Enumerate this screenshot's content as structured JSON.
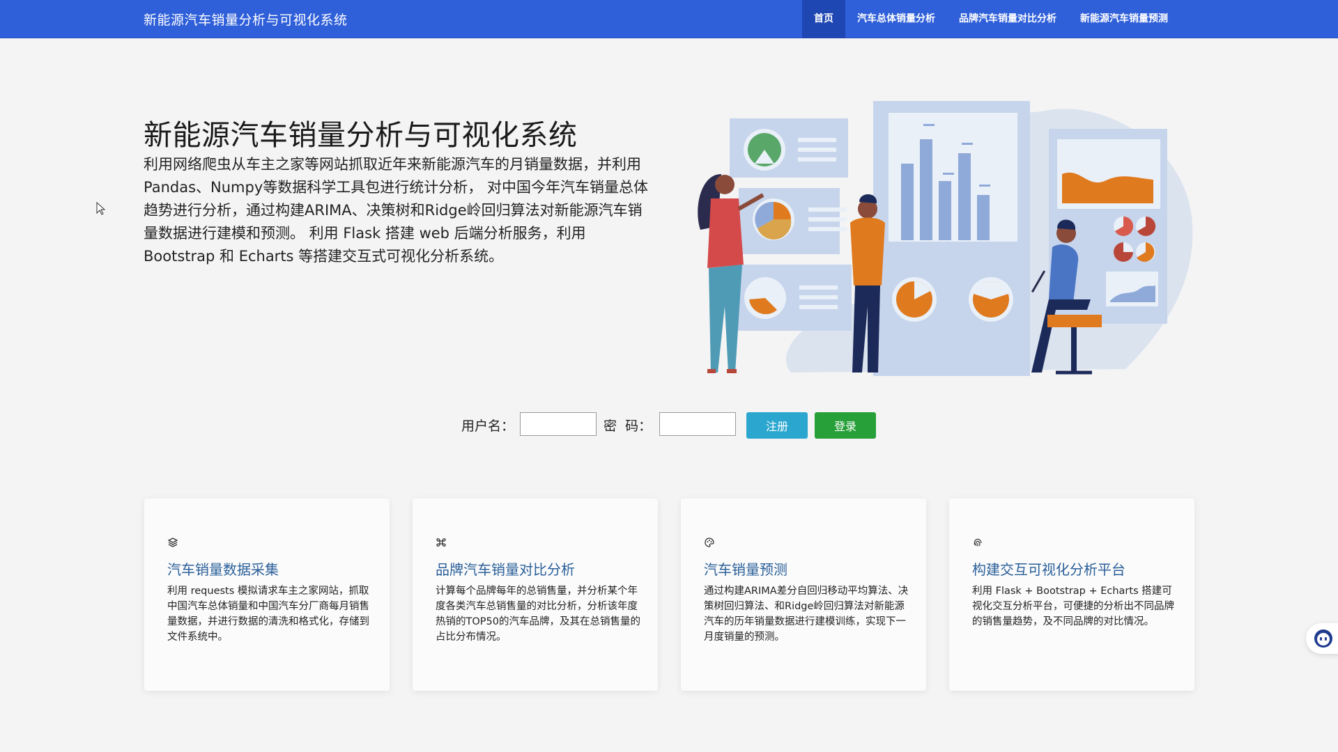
{
  "nav": {
    "brand": "新能源汽车销量分析与可视化系统",
    "items": [
      {
        "label": "首页",
        "active": true
      },
      {
        "label": "汽车总体销量分析",
        "active": false
      },
      {
        "label": "品牌汽车销量对比分析",
        "active": false
      },
      {
        "label": "新能源汽车销量预测",
        "active": false
      }
    ]
  },
  "hero": {
    "title": "新能源汽车销量分析与可视化系统",
    "description": "利用网络爬虫从车主之家等网站抓取近年来新能源汽车的月销量数据，并利用Pandas、Numpy等数据科学工具包进行统计分析， 对中国今年汽车销量总体趋势进行分析，通过构建ARIMA、决策树和Ridge岭回归算法对新能源汽车销量数据进行建模和预测。 利用 Flask 搭建 web 后端分析服务，利用 Bootstrap 和 Echarts 等搭建交互式可视化分析系统。"
  },
  "login": {
    "username_label": "用户名：",
    "password_label": "密  码：",
    "username_value": "",
    "password_value": "",
    "register_label": "注册",
    "login_label": "登录"
  },
  "cards": [
    {
      "icon": "layers-icon",
      "title": "汽车销量数据采集",
      "desc": "利用 requests 模拟请求车主之家网站，抓取中国汽车总体销量和中国汽车分厂商每月销售量数据，并进行数据的清洗和格式化，存储到文件系统中。"
    },
    {
      "icon": "command-icon",
      "title": "品牌汽车销量对比分析",
      "desc": "计算每个品牌每年的总销售量，并分析某个年度各类汽车总销售量的对比分析，分析该年度热销的TOP50的汽车品牌，及其在总销售量的占比分布情况。"
    },
    {
      "icon": "palette-icon",
      "title": "汽车销量预测",
      "desc": "通过构建ARIMA差分自回归移动平均算法、决策树回归算法、和Ridge岭回归算法对新能源汽车的历年销量数据进行建模训练，实现下一月度销量的预测。"
    },
    {
      "icon": "fingerprint-icon",
      "title": "构建交互可视化分析平台",
      "desc": "利用 Flask + Bootstrap + Echarts 搭建可视化交互分析平台，可便捷的分析出不同品牌的销售量趋势，及不同品牌的对比情况。"
    }
  ],
  "colors": {
    "nav_bg": "#2f5fd9",
    "nav_active": "#1f47b3",
    "register_btn": "#2ba7cf",
    "login_btn": "#27a03a",
    "card_title": "#2a5f99",
    "illustration_orange": "#e07a1f",
    "illustration_blue": "#8fa9d9"
  }
}
